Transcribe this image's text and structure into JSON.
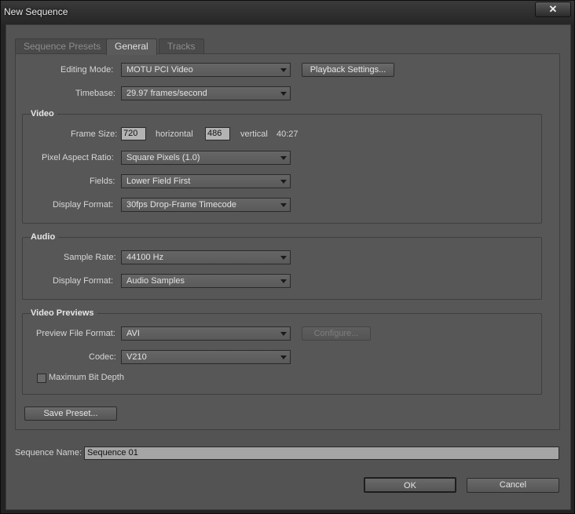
{
  "window": {
    "title": "New Sequence",
    "close_glyph": "✕"
  },
  "tabs": [
    {
      "label": "Sequence Presets",
      "active": false
    },
    {
      "label": "General",
      "active": true
    },
    {
      "label": "Tracks",
      "active": false
    }
  ],
  "general": {
    "editing_mode": {
      "label": "Editing Mode:",
      "value": "MOTU PCI Video"
    },
    "playback_settings_label": "Playback Settings...",
    "timebase": {
      "label": "Timebase:",
      "value": "29.97 frames/second"
    }
  },
  "video": {
    "title": "Video",
    "frame_size": {
      "label": "Frame Size:",
      "width": "720",
      "horizontal_label": "horizontal",
      "height": "486",
      "vertical_label": "vertical",
      "ratio": "40:27"
    },
    "pixel_aspect_ratio": {
      "label": "Pixel Aspect Ratio:",
      "value": "Square Pixels (1.0)"
    },
    "fields": {
      "label": "Fields:",
      "value": "Lower Field First"
    },
    "display_format": {
      "label": "Display Format:",
      "value": "30fps Drop-Frame Timecode"
    }
  },
  "audio": {
    "title": "Audio",
    "sample_rate": {
      "label": "Sample Rate:",
      "value": "44100 Hz"
    },
    "display_format": {
      "label": "Display Format:",
      "value": "Audio Samples"
    }
  },
  "video_previews": {
    "title": "Video Previews",
    "preview_file_format": {
      "label": "Preview File Format:",
      "value": "AVI"
    },
    "configure_label": "Configure...",
    "codec": {
      "label": "Codec:",
      "value": "V210"
    },
    "max_bit_depth": {
      "label": "Maximum Bit Depth",
      "checked": false
    }
  },
  "save_preset_label": "Save Preset...",
  "sequence_name": {
    "label": "Sequence Name:",
    "value": "Sequence 01"
  },
  "ok_label": "OK",
  "cancel_label": "Cancel"
}
